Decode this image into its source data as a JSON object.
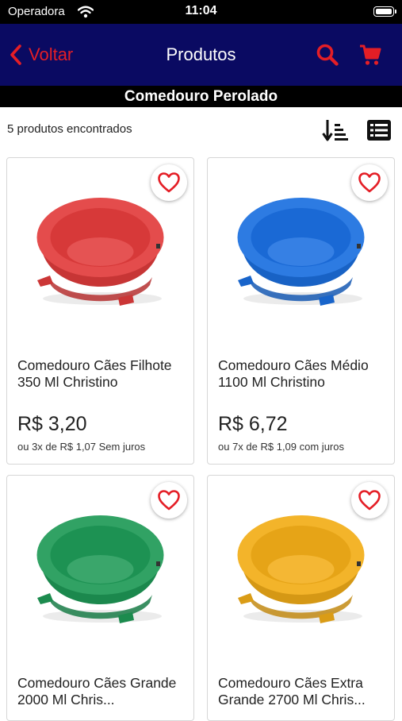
{
  "status_bar": {
    "carrier": "Operadora",
    "time": "11:04"
  },
  "nav": {
    "back_label": "Voltar",
    "title": "Produtos"
  },
  "category_title": "Comedouro Perolado",
  "results": {
    "count_text": "5 produtos encontrados"
  },
  "colors": {
    "navbar": "#0a0a62",
    "accent": "#e41e26",
    "category_bar": "#000000"
  },
  "products": [
    {
      "name": "Comedouro Cães Filhote 350 Ml Christino",
      "price": "R$ 3,20",
      "installments": "ou 3x de R$ 1,07 Sem juros",
      "bowl_color": "#e23c3c"
    },
    {
      "name": "Comedouro Cães Médio 1100 Ml Christino",
      "price": "R$ 6,72",
      "installments": "ou 7x de R$ 1,09 com juros",
      "bowl_color": "#1b6fe0"
    },
    {
      "name": "Comedouro Cães Grande 2000 Ml Chris...",
      "price": "",
      "installments": "",
      "bowl_color": "#1f9a57"
    },
    {
      "name": "Comedouro Cães Extra Grande 2700 Ml Chris...",
      "price": "",
      "installments": "",
      "bowl_color": "#f2ad18"
    }
  ],
  "icons": {
    "back": "chevron-left-icon",
    "search": "search-icon",
    "cart": "cart-icon",
    "sort": "sort-icon",
    "list": "list-view-icon",
    "favorite": "heart-icon"
  }
}
